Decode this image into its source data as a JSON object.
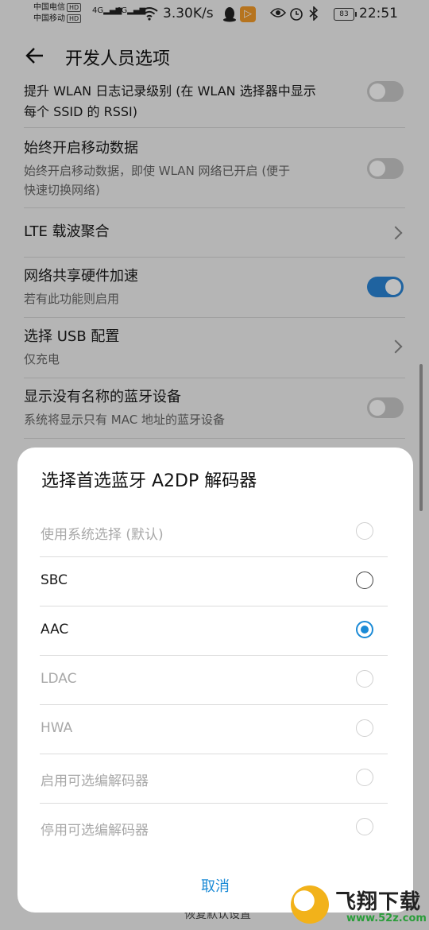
{
  "status_bar": {
    "carrier_1": "中国电信",
    "carrier_2": "中国移动",
    "hd": "HD",
    "net_1": "4G",
    "net_2": "4G",
    "speed": "3.30K/s",
    "battery": "83",
    "time": "22:51"
  },
  "header": {
    "title": "开发人员选项"
  },
  "settings": {
    "wlan_log": {
      "title": "提升 WLAN 日志记录级别 (在 WLAN 选择器中显示",
      "subtitle": "每个 SSID 的 RSSI)",
      "toggle_on": false
    },
    "mobile_data": {
      "title": "始终开启移动数据",
      "subtitle_1": "始终开启移动数据，即使 WLAN 网络已开启 (便于",
      "subtitle_2": "快速切换网络)",
      "toggle_on": false
    },
    "lte": {
      "title": "LTE 载波聚合"
    },
    "tethering": {
      "title": "网络共享硬件加速",
      "subtitle": "若有此功能则启用",
      "toggle_on": true
    },
    "usb": {
      "title": "选择 USB 配置",
      "subtitle": "仅充电"
    },
    "bt_names": {
      "title": "显示没有名称的蓝牙设备",
      "subtitle": "系统将显示只有 MAC 地址的蓝牙设备",
      "toggle_on": false
    }
  },
  "dialog": {
    "title": "选择首选蓝牙 A2DP 解码器",
    "options": [
      {
        "label": "使用系统选择 (默认)",
        "state": "disabled"
      },
      {
        "label": "SBC",
        "state": "enabled"
      },
      {
        "label": "AAC",
        "state": "selected"
      },
      {
        "label": "LDAC",
        "state": "disabled"
      },
      {
        "label": "HWA",
        "state": "disabled"
      },
      {
        "label": "启用可选编解码器",
        "state": "disabled"
      },
      {
        "label": "停用可选编解码器",
        "state": "disabled"
      }
    ],
    "cancel": "取消"
  },
  "behind": {
    "reset": "恢复默认设置"
  },
  "watermark": {
    "name": "飞翔下载",
    "url": "www.52z.com"
  },
  "colors": {
    "accent": "#1a8ad6",
    "toggle_on": "#2a84d6"
  }
}
